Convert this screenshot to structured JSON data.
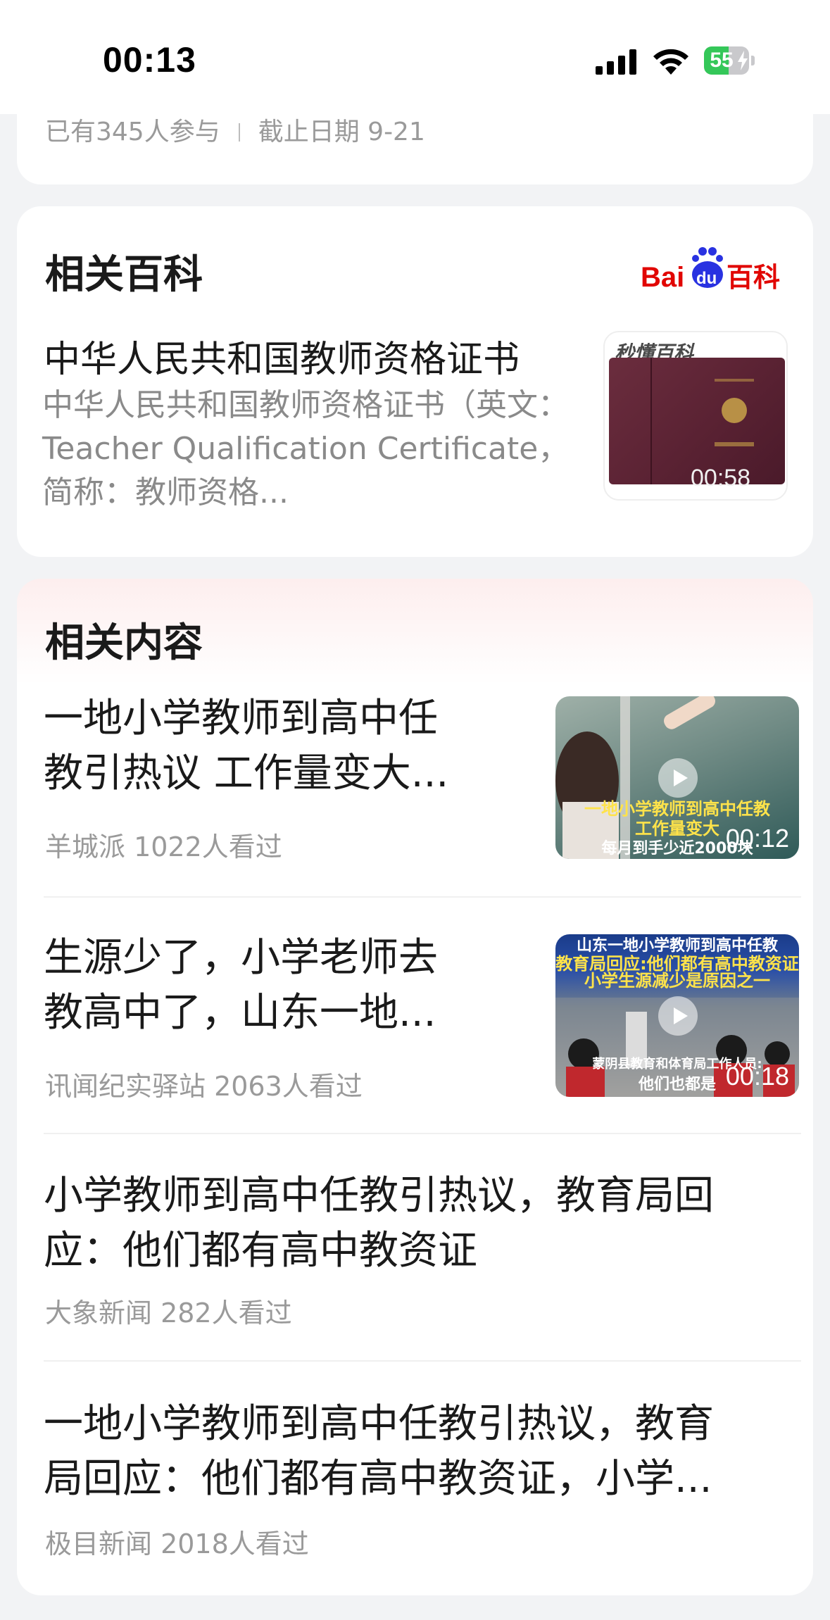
{
  "status_bar": {
    "time": "00:13",
    "battery": "55",
    "battery_level": 0.55
  },
  "top_card": {
    "participants": "已有345人参与",
    "deadline": "截止日期 9-21"
  },
  "baike": {
    "section_title": "相关百科",
    "logo_text_bai": "Bai",
    "logo_text_du": "du",
    "logo_text_baike": "百科",
    "entry_title": "中华人民共和国教师资格证书",
    "entry_desc": "中华人民共和国教师资格证书（英文：Teacher Qualification Certificate，简称：教师资格...",
    "thumb_watermark": "秒懂百科",
    "thumb_duration": "00:58"
  },
  "related": {
    "section_title": "相关内容",
    "items": [
      {
        "title_line1": "一地小学教师到高中任",
        "title_line2": "教引热议 工作量变大...",
        "source": "羊城派  1022人看过",
        "duration": "00:12",
        "caption1": "一地小学教师到高中任教",
        "caption2": "工作量变大",
        "caption3": "每月到手少近2000块"
      },
      {
        "title_line1": "生源少了，小学老师去",
        "title_line2": "教高中了，山东一地...",
        "source": "讯闻纪实驿站  2063人看过",
        "duration": "00:18",
        "caption1": "山东一地小学教师到高中任教",
        "caption2": "教育局回应:他们都有高中教资证",
        "caption3": "小学生源减少是原因之一",
        "caption4": "蒙阴县教育和体育局工作人员:",
        "caption5": "他们也都是"
      },
      {
        "title_line1": "小学教师到高中任教引热议，教育局回",
        "title_line2": "应：他们都有高中教资证",
        "source": "大象新闻  282人看过"
      },
      {
        "title_line1": "一地小学教师到高中任教引热议，教育",
        "title_line2": "局回应：他们都有高中教资证，小学...",
        "source": "极目新闻  2018人看过"
      }
    ]
  },
  "colors": {
    "baidu_red": "#e10602",
    "baidu_blue": "#2932e1",
    "battery_green": "#34c759"
  }
}
